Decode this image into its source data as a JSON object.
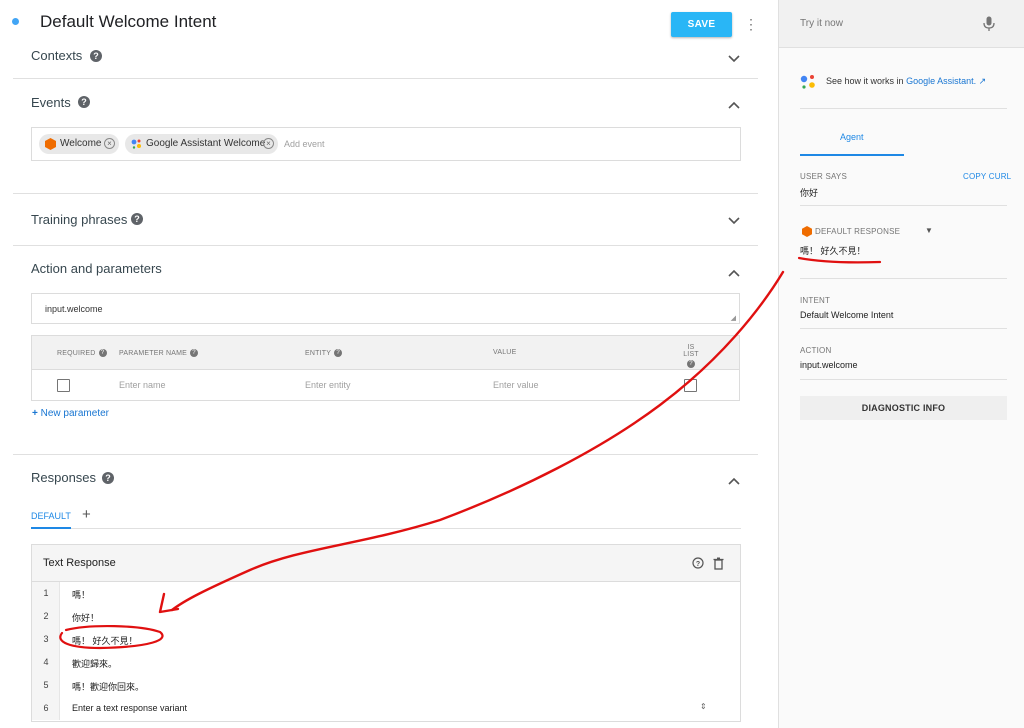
{
  "header": {
    "title": "Default Welcome Intent",
    "save_label": "SAVE"
  },
  "sections": {
    "contexts": "Contexts",
    "events": "Events",
    "training": "Training phrases",
    "action": "Action and parameters",
    "responses": "Responses"
  },
  "events": {
    "chips": [
      {
        "label": "Welcome",
        "icon": "dialogflow-icon"
      },
      {
        "label": "Google Assistant Welcome",
        "icon": "google-assistant-icon"
      }
    ],
    "placeholder": "Add event"
  },
  "action": {
    "value": "input.welcome",
    "table_headers": {
      "required": "REQUIRED",
      "param_name": "PARAMETER NAME",
      "entity": "ENTITY",
      "value": "VALUE",
      "is_list": "IS LIST"
    },
    "row": {
      "name_placeholder": "Enter name",
      "entity_placeholder": "Enter entity",
      "value_placeholder": "Enter value"
    },
    "new_parameter": "New parameter"
  },
  "responses": {
    "tab_default": "DEFAULT",
    "tab_add": "+",
    "card_title": "Text Response",
    "lines": [
      {
        "n": "1",
        "text": "嗎！"
      },
      {
        "n": "2",
        "text": "你好！"
      },
      {
        "n": "3",
        "text": "嗎！ 好久不見！"
      },
      {
        "n": "4",
        "text": "歡迎歸來。"
      },
      {
        "n": "5",
        "text": "嗎！歡迎你回來。"
      },
      {
        "n": "6",
        "text": ""
      }
    ],
    "input_placeholder": "Enter a text response variant"
  },
  "side": {
    "try_placeholder": "Try it now",
    "assistant_text": "See how it works in",
    "assistant_link": "Google Assistant.",
    "tab_agent": "Agent",
    "user_says_label": "USER SAYS",
    "copy_curl": "COPY CURL",
    "user_says": "你好",
    "default_response_label": "DEFAULT RESPONSE",
    "default_response": "嗎！ 好久不見！",
    "intent_label": "INTENT",
    "intent_value": "Default Welcome Intent",
    "action_label": "ACTION",
    "action_value": "input.welcome",
    "diagnostic": "DIAGNOSTIC INFO"
  },
  "colors": {
    "accent": "#29b6f6",
    "link": "#1976d2",
    "annotation": "#e01010"
  }
}
